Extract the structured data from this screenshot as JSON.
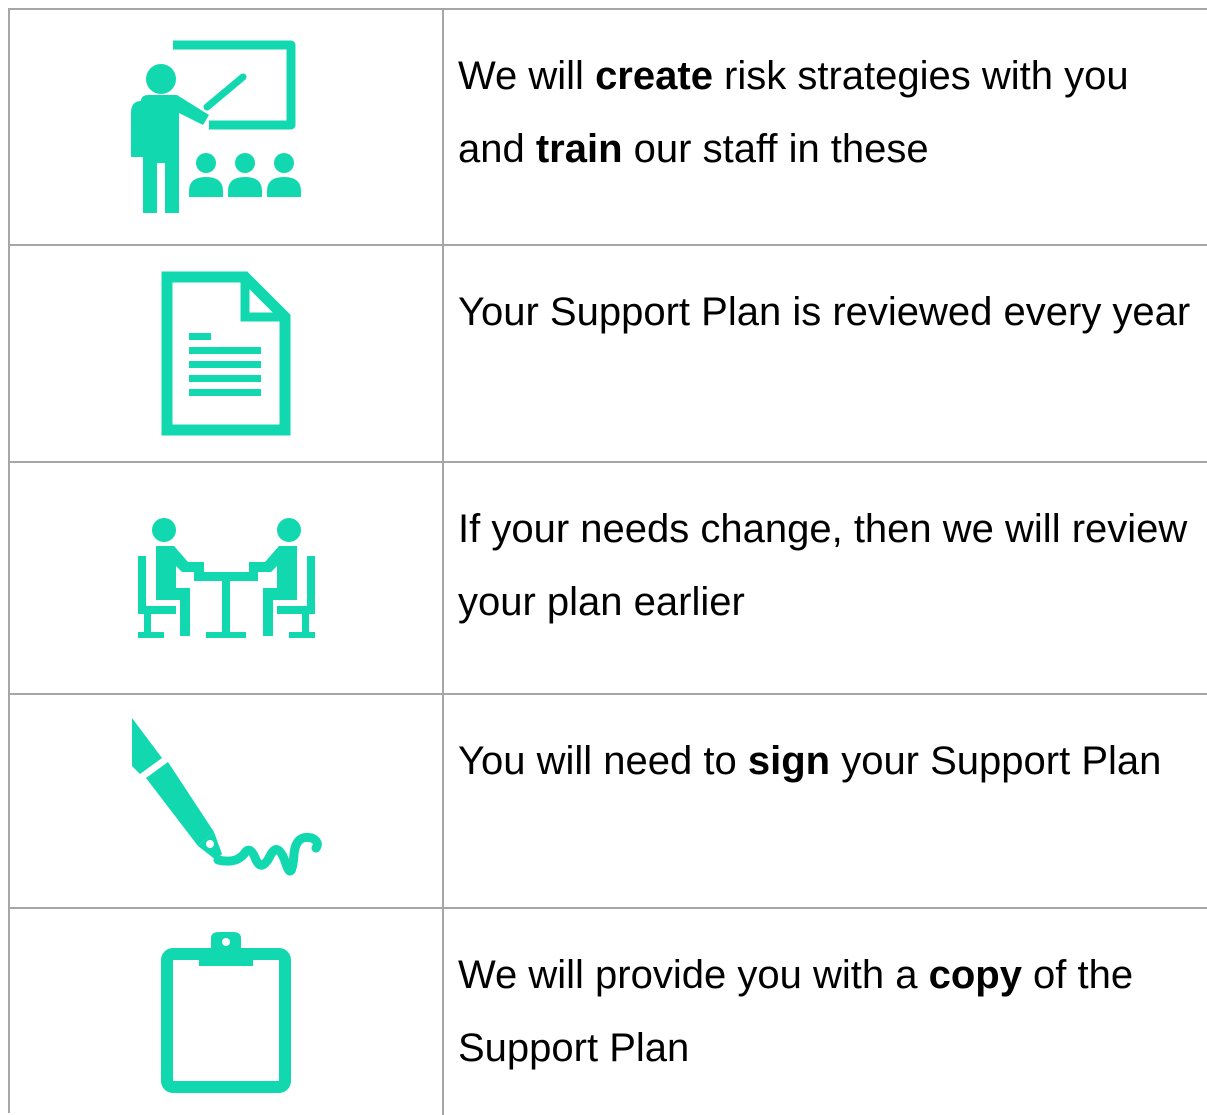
{
  "accent_color": "#12d8b0",
  "rows": [
    {
      "icon": "presentation-icon",
      "parts": [
        "We will ",
        "create",
        " risk strategies with you and ",
        "train",
        " our staff in these"
      ]
    },
    {
      "icon": "document-icon",
      "parts": [
        "Your Support Plan is reviewed every year"
      ]
    },
    {
      "icon": "meeting-icon",
      "parts": [
        "If your needs change, then we will review your plan earlier"
      ]
    },
    {
      "icon": "pen-signature-icon",
      "parts": [
        "You will need to ",
        "sign",
        " your Support Plan"
      ]
    },
    {
      "icon": "clipboard-icon",
      "parts": [
        "We will provide you with a ",
        "copy",
        " of the Support Plan"
      ]
    }
  ]
}
